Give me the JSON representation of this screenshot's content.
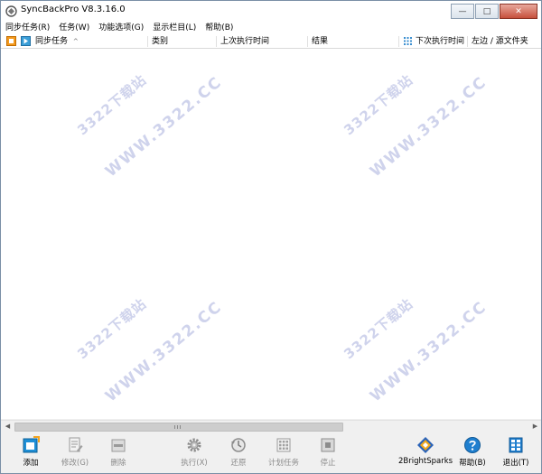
{
  "window": {
    "title": "SyncBackPro V8.3.16.0"
  },
  "menu": [
    {
      "label": "同步任务(R)"
    },
    {
      "label": "任务(W)"
    },
    {
      "label": "功能选项(G)"
    },
    {
      "label": "显示栏目(L)"
    },
    {
      "label": "帮助(B)"
    }
  ],
  "columns": {
    "name": "同步任务",
    "sort_indicator": "^",
    "category": "类别",
    "last_run": "上次执行时间",
    "result": "结果",
    "next_run": "下次执行时间",
    "source": "左边 / 源文件夹"
  },
  "watermarks": [
    {
      "domain": "3322下载站",
      "url": "WWW.3322.CC"
    },
    {
      "domain": "3322下载站",
      "url": "WWW.3322.CC"
    },
    {
      "domain": "3322下载站",
      "url": "WWW.3322.CC"
    },
    {
      "domain": "3322下载站",
      "url": "WWW.3322.CC"
    }
  ],
  "toolbar": {
    "add": "添加",
    "modify": "修改(G)",
    "delete": "删除",
    "run": "执行(X)",
    "restore": "还原",
    "schedule": "计划任务",
    "stop": "停止",
    "brand": "2BrightSparks",
    "help": "帮助(B)",
    "exit": "退出(T)"
  }
}
